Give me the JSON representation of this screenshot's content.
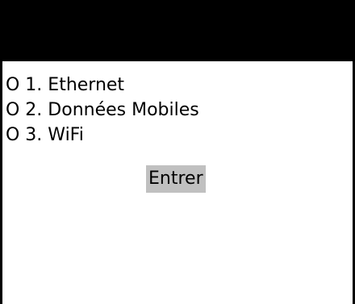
{
  "menu": {
    "items": [
      {
        "label": "O 1. Ethernet"
      },
      {
        "label": "O 2. Données Mobiles"
      },
      {
        "label": "O 3. WiFi"
      }
    ]
  },
  "actions": {
    "enter_label": "Entrer"
  },
  "colors": {
    "topbar": "#000000",
    "background": "#ffffff",
    "button_bg": "#c0c0c0",
    "text": "#000000"
  }
}
